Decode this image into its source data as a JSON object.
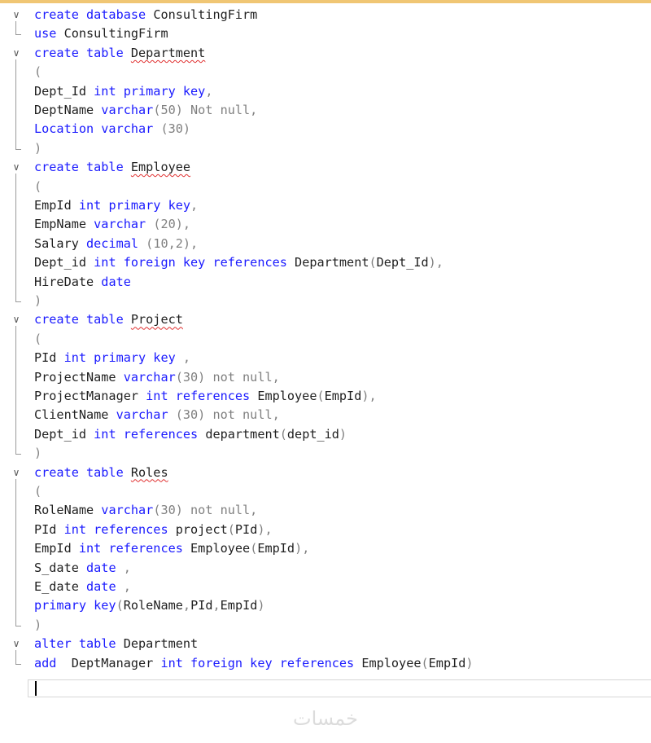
{
  "editor": {
    "fold_glyph": "∨",
    "lines": [
      {
        "fold": true,
        "tokens": [
          {
            "t": "create database ",
            "c": "k"
          },
          {
            "t": "ConsultingFirm",
            "c": "i"
          }
        ]
      },
      {
        "fold": false,
        "tokens": [
          {
            "t": "use ",
            "c": "k"
          },
          {
            "t": "ConsultingFirm",
            "c": "i"
          }
        ]
      },
      {
        "fold": true,
        "tokens": [
          {
            "t": "create table ",
            "c": "k"
          },
          {
            "t": "Department",
            "c": "i",
            "squig": true
          }
        ]
      },
      {
        "fold": false,
        "tokens": [
          {
            "t": "(",
            "c": "p"
          }
        ]
      },
      {
        "fold": false,
        "tokens": [
          {
            "t": "Dept_Id ",
            "c": "i"
          },
          {
            "t": "int primary key",
            "c": "k"
          },
          {
            "t": ",",
            "c": "p"
          }
        ]
      },
      {
        "fold": false,
        "tokens": [
          {
            "t": "DeptName ",
            "c": "i"
          },
          {
            "t": "varchar",
            "c": "k"
          },
          {
            "t": "(50) Not null,",
            "c": "g"
          }
        ]
      },
      {
        "fold": false,
        "tokens": [
          {
            "t": "Location varchar ",
            "c": "k"
          },
          {
            "t": "(30)",
            "c": "g"
          }
        ]
      },
      {
        "fold": false,
        "tokens": [
          {
            "t": ")",
            "c": "p"
          }
        ]
      },
      {
        "fold": true,
        "tokens": [
          {
            "t": "create table ",
            "c": "k"
          },
          {
            "t": "Employee",
            "c": "i",
            "squig": true
          }
        ]
      },
      {
        "fold": false,
        "tokens": [
          {
            "t": "(",
            "c": "p"
          }
        ]
      },
      {
        "fold": false,
        "tokens": [
          {
            "t": "EmpId ",
            "c": "i"
          },
          {
            "t": "int primary key",
            "c": "k"
          },
          {
            "t": ",",
            "c": "p"
          }
        ]
      },
      {
        "fold": false,
        "tokens": [
          {
            "t": "EmpName ",
            "c": "i"
          },
          {
            "t": "varchar ",
            "c": "k"
          },
          {
            "t": "(20),",
            "c": "g"
          }
        ]
      },
      {
        "fold": false,
        "tokens": [
          {
            "t": "Salary ",
            "c": "i"
          },
          {
            "t": "decimal ",
            "c": "k"
          },
          {
            "t": "(10,2),",
            "c": "g"
          }
        ]
      },
      {
        "fold": false,
        "tokens": [
          {
            "t": "Dept_id ",
            "c": "i"
          },
          {
            "t": "int foreign key references ",
            "c": "k"
          },
          {
            "t": "Department",
            "c": "i"
          },
          {
            "t": "(",
            "c": "g"
          },
          {
            "t": "Dept_Id",
            "c": "i"
          },
          {
            "t": "),",
            "c": "g"
          }
        ]
      },
      {
        "fold": false,
        "tokens": [
          {
            "t": "HireDate ",
            "c": "i"
          },
          {
            "t": "date",
            "c": "k"
          }
        ]
      },
      {
        "fold": false,
        "tokens": [
          {
            "t": ")",
            "c": "p"
          }
        ]
      },
      {
        "fold": true,
        "tokens": [
          {
            "t": "create table ",
            "c": "k"
          },
          {
            "t": "Project",
            "c": "i",
            "squig": true
          }
        ]
      },
      {
        "fold": false,
        "tokens": [
          {
            "t": "(",
            "c": "p"
          }
        ]
      },
      {
        "fold": false,
        "tokens": [
          {
            "t": "PId ",
            "c": "i"
          },
          {
            "t": "int primary key ",
            "c": "k"
          },
          {
            "t": ",",
            "c": "p"
          }
        ]
      },
      {
        "fold": false,
        "tokens": [
          {
            "t": "ProjectName ",
            "c": "i"
          },
          {
            "t": "varchar",
            "c": "k"
          },
          {
            "t": "(30) not null,",
            "c": "g"
          }
        ]
      },
      {
        "fold": false,
        "tokens": [
          {
            "t": "ProjectManager ",
            "c": "i"
          },
          {
            "t": "int references ",
            "c": "k"
          },
          {
            "t": "Employee",
            "c": "i"
          },
          {
            "t": "(",
            "c": "g"
          },
          {
            "t": "EmpId",
            "c": "i"
          },
          {
            "t": "),",
            "c": "g"
          }
        ]
      },
      {
        "fold": false,
        "tokens": [
          {
            "t": "ClientName ",
            "c": "i"
          },
          {
            "t": "varchar ",
            "c": "k"
          },
          {
            "t": "(30) not null,",
            "c": "g"
          }
        ]
      },
      {
        "fold": false,
        "tokens": [
          {
            "t": "Dept_id ",
            "c": "i"
          },
          {
            "t": "int references ",
            "c": "k"
          },
          {
            "t": "department",
            "c": "i"
          },
          {
            "t": "(",
            "c": "g"
          },
          {
            "t": "dept_id",
            "c": "i"
          },
          {
            "t": ")",
            "c": "g"
          }
        ]
      },
      {
        "fold": false,
        "tokens": [
          {
            "t": ")",
            "c": "p"
          }
        ]
      },
      {
        "fold": true,
        "tokens": [
          {
            "t": "create table ",
            "c": "k"
          },
          {
            "t": "Roles",
            "c": "i",
            "squig": true
          }
        ]
      },
      {
        "fold": false,
        "tokens": [
          {
            "t": "(",
            "c": "p"
          }
        ]
      },
      {
        "fold": false,
        "tokens": [
          {
            "t": "RoleName ",
            "c": "i"
          },
          {
            "t": "varchar",
            "c": "k"
          },
          {
            "t": "(30) not null,",
            "c": "g"
          }
        ]
      },
      {
        "fold": false,
        "tokens": [
          {
            "t": "PId ",
            "c": "i"
          },
          {
            "t": "int references ",
            "c": "k"
          },
          {
            "t": "project",
            "c": "i"
          },
          {
            "t": "(",
            "c": "g"
          },
          {
            "t": "PId",
            "c": "i"
          },
          {
            "t": "),",
            "c": "g"
          }
        ]
      },
      {
        "fold": false,
        "tokens": [
          {
            "t": "EmpId ",
            "c": "i"
          },
          {
            "t": "int references ",
            "c": "k"
          },
          {
            "t": "Employee",
            "c": "i"
          },
          {
            "t": "(",
            "c": "g"
          },
          {
            "t": "EmpId",
            "c": "i"
          },
          {
            "t": "),",
            "c": "g"
          }
        ]
      },
      {
        "fold": false,
        "tokens": [
          {
            "t": "S_date ",
            "c": "i"
          },
          {
            "t": "date ",
            "c": "k"
          },
          {
            "t": ",",
            "c": "p"
          }
        ]
      },
      {
        "fold": false,
        "tokens": [
          {
            "t": "E_date ",
            "c": "i"
          },
          {
            "t": "date ",
            "c": "k"
          },
          {
            "t": ",",
            "c": "p"
          }
        ]
      },
      {
        "fold": false,
        "tokens": [
          {
            "t": "primary key",
            "c": "k"
          },
          {
            "t": "(",
            "c": "g"
          },
          {
            "t": "RoleName",
            "c": "i"
          },
          {
            "t": ",",
            "c": "g"
          },
          {
            "t": "PId",
            "c": "i"
          },
          {
            "t": ",",
            "c": "g"
          },
          {
            "t": "EmpId",
            "c": "i"
          },
          {
            "t": ")",
            "c": "g"
          }
        ]
      },
      {
        "fold": false,
        "tokens": [
          {
            "t": ")",
            "c": "p"
          }
        ]
      },
      {
        "fold": true,
        "tokens": [
          {
            "t": "alter table ",
            "c": "k"
          },
          {
            "t": "Department",
            "c": "i"
          }
        ]
      },
      {
        "fold": false,
        "tokens": [
          {
            "t": "add  ",
            "c": "k"
          },
          {
            "t": "DeptManager ",
            "c": "i"
          },
          {
            "t": "int foreign key references ",
            "c": "k"
          },
          {
            "t": "Employee",
            "c": "i"
          },
          {
            "t": "(",
            "c": "g"
          },
          {
            "t": "EmpId",
            "c": "i"
          },
          {
            "t": ")",
            "c": "g"
          }
        ]
      }
    ]
  },
  "watermark": "خمسات",
  "colors": {
    "keyword": "#1a1aff",
    "identifier": "#1f1f1f",
    "gray": "#808080",
    "squiggle": "#e03030",
    "top_strip": "#f0c674"
  }
}
